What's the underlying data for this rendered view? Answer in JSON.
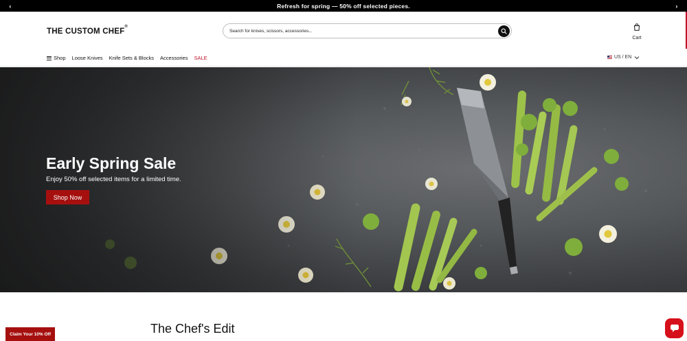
{
  "announcement": {
    "text": "Refresh for spring — 50% off selected pieces.",
    "prev_icon": "chevron-left-icon",
    "next_icon": "chevron-right-icon"
  },
  "header": {
    "logo_text": "THE CUSTOM CHEF",
    "logo_trademark": "®",
    "search": {
      "placeholder": "Search for knives, scissors, accessories...",
      "value": "",
      "icon": "search-icon"
    },
    "cart": {
      "label": "Cart",
      "icon": "shopping-bag-icon"
    },
    "nav": {
      "items": [
        {
          "label": "Shop",
          "icon": "menu-icon"
        },
        {
          "label": "Loose Knives"
        },
        {
          "label": "Knife Sets & Blocks"
        },
        {
          "label": "Accessories"
        },
        {
          "label": "SALE",
          "color": "#c0142a"
        }
      ]
    },
    "locale": {
      "label": "US / EN",
      "icon": "us-flag-icon",
      "dropdown_icon": "chevron-down-icon"
    }
  },
  "hero": {
    "title": "Early Spring Sale",
    "subtitle": "Enjoy 50% off selected items for a limited time.",
    "cta_label": "Shop Now",
    "image_content": "knife-with-celery-and-flowers-image"
  },
  "sections": {
    "chefs_edit_title": "The Chef's Edit"
  },
  "promo": {
    "claim_label": "Claim Your 10% Off"
  },
  "chat": {
    "icon": "chat-icon"
  },
  "colors": {
    "accent": "#a5100f",
    "sale": "#c0142a",
    "announcement_bg": "#000000",
    "chat": "#d6101a"
  }
}
